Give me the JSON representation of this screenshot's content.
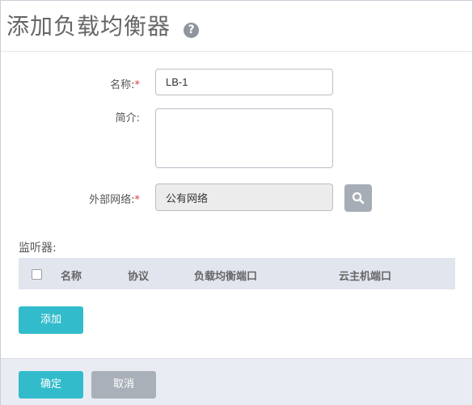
{
  "dialog": {
    "title": "添加负载均衡器",
    "help_symbol": "?"
  },
  "form": {
    "name_label": "名称:",
    "name_required": "*",
    "name_value": "LB-1",
    "desc_label": "简介:",
    "desc_value": "",
    "network_label": "外部网络:",
    "network_required": "*",
    "network_value": "公有网络"
  },
  "listeners": {
    "section_label": "监听器:",
    "columns": [
      "名称",
      "协议",
      "负载均衡端口",
      "云主机端口"
    ],
    "add_label": "添加"
  },
  "footer": {
    "confirm_label": "确定",
    "cancel_label": "取消"
  },
  "colors": {
    "primary": "#32bccb",
    "secondary": "#aab0b9",
    "required": "#e03a3a"
  }
}
